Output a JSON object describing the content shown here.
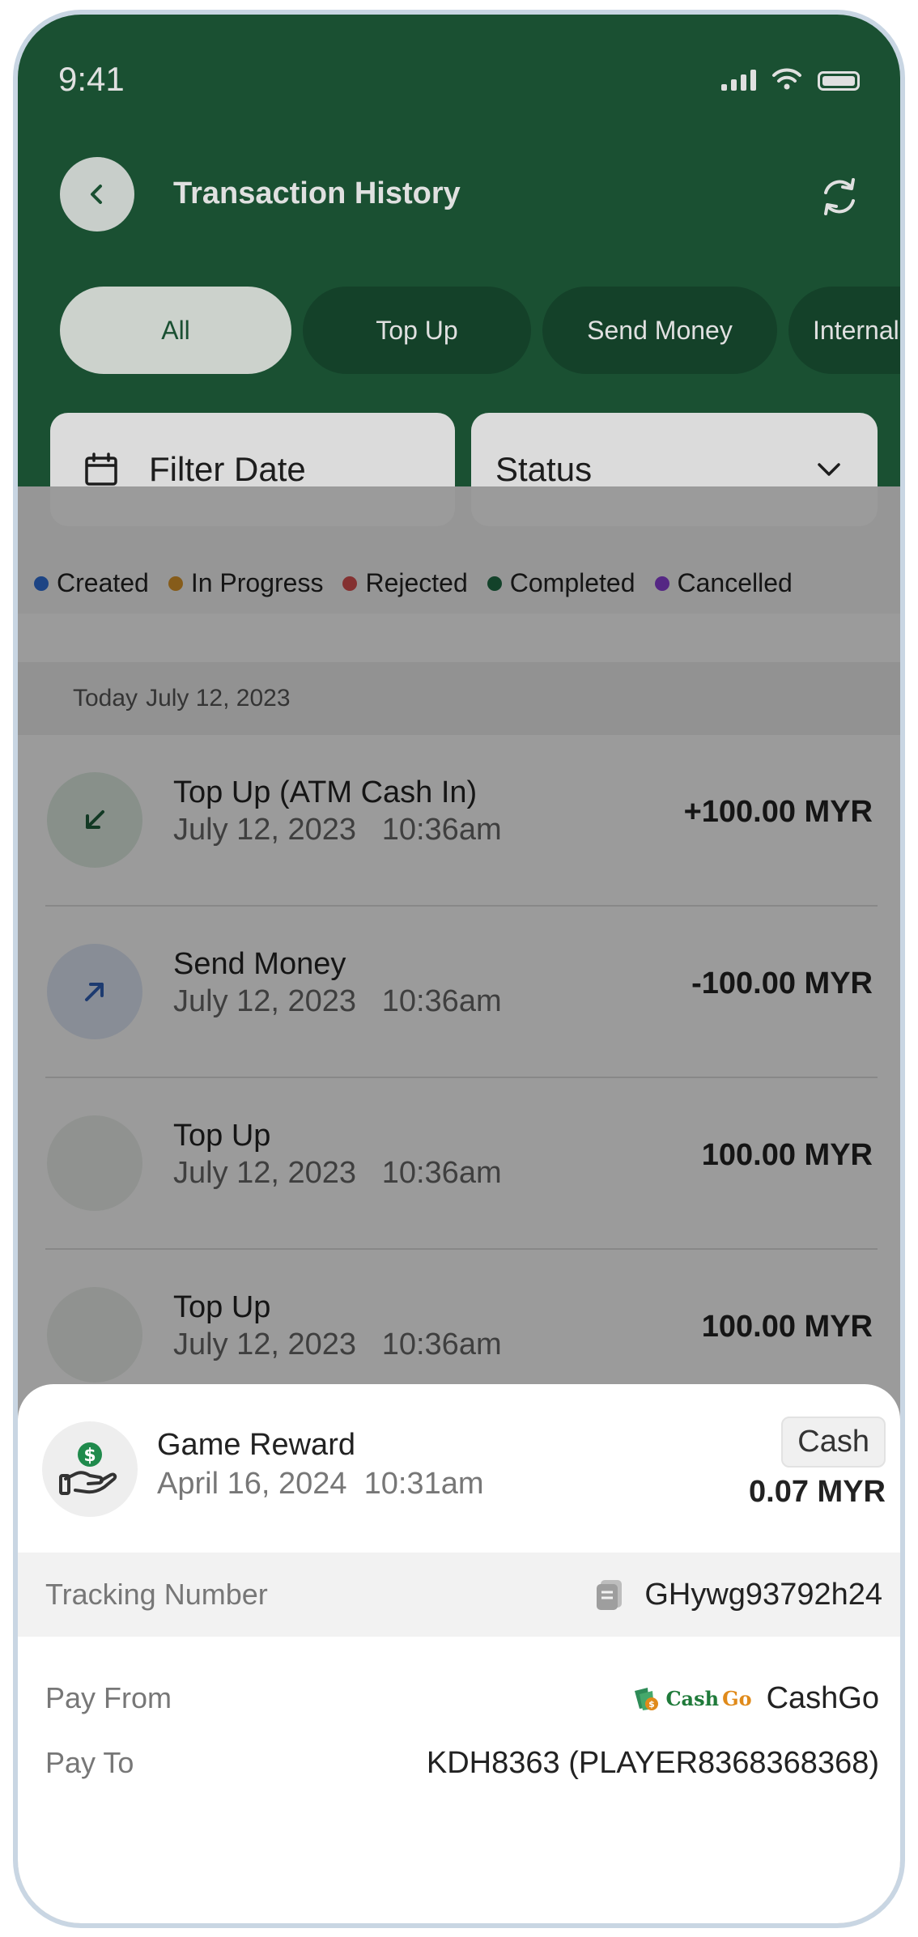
{
  "status_bar": {
    "time": "9:41"
  },
  "header": {
    "title": "Transaction History"
  },
  "tabs": [
    {
      "label": "All",
      "active": true
    },
    {
      "label": "Top Up",
      "active": false
    },
    {
      "label": "Send Money",
      "active": false
    },
    {
      "label": "Internal",
      "active": false
    }
  ],
  "filters": {
    "date_label": "Filter Date",
    "status_label": "Status"
  },
  "legend": [
    {
      "label": "Created",
      "color": "#2f6fd6"
    },
    {
      "label": "In Progress",
      "color": "#d9952b"
    },
    {
      "label": "Rejected",
      "color": "#d65050"
    },
    {
      "label": "Completed",
      "color": "#1f6b45"
    },
    {
      "label": "Cancelled",
      "color": "#8a3fd6"
    }
  ],
  "date_group": {
    "day": "Today",
    "date": "July 12, 2023"
  },
  "transactions": [
    {
      "title": "Top Up (ATM Cash In)",
      "date": "July 12, 2023   10:36am",
      "amount": "+100.00 MYR",
      "icon": "arrow-down-left-icon"
    },
    {
      "title": "Send Money",
      "date": "July 12, 2023   10:36am",
      "amount": "-100.00 MYR",
      "icon": "arrow-up-right-icon"
    },
    {
      "title": "Top Up",
      "date": "July 12, 2023   10:36am",
      "amount": "100.00 MYR",
      "icon": ""
    },
    {
      "title": "Top Up",
      "date": "July 12, 2023   10:36am",
      "amount": "100.00 MYR",
      "icon": ""
    }
  ],
  "sheet": {
    "title": "Game Reward",
    "date": "April 16, 2024  10:31am",
    "badge": "Cash",
    "amount": "0.07 MYR",
    "tracking_label": "Tracking Number",
    "tracking_value": "GHywg93792h24",
    "pay_from_label": "Pay From",
    "pay_from_logo_text_1": "Cash",
    "pay_from_logo_text_2": "Go",
    "pay_from_value": "CashGo",
    "pay_to_label": "Pay To",
    "pay_to_value": "KDH8363 (PLAYER8368368368)"
  },
  "colors": {
    "header_green": "#1e5c3a",
    "tab_dark": "#174a2f"
  }
}
